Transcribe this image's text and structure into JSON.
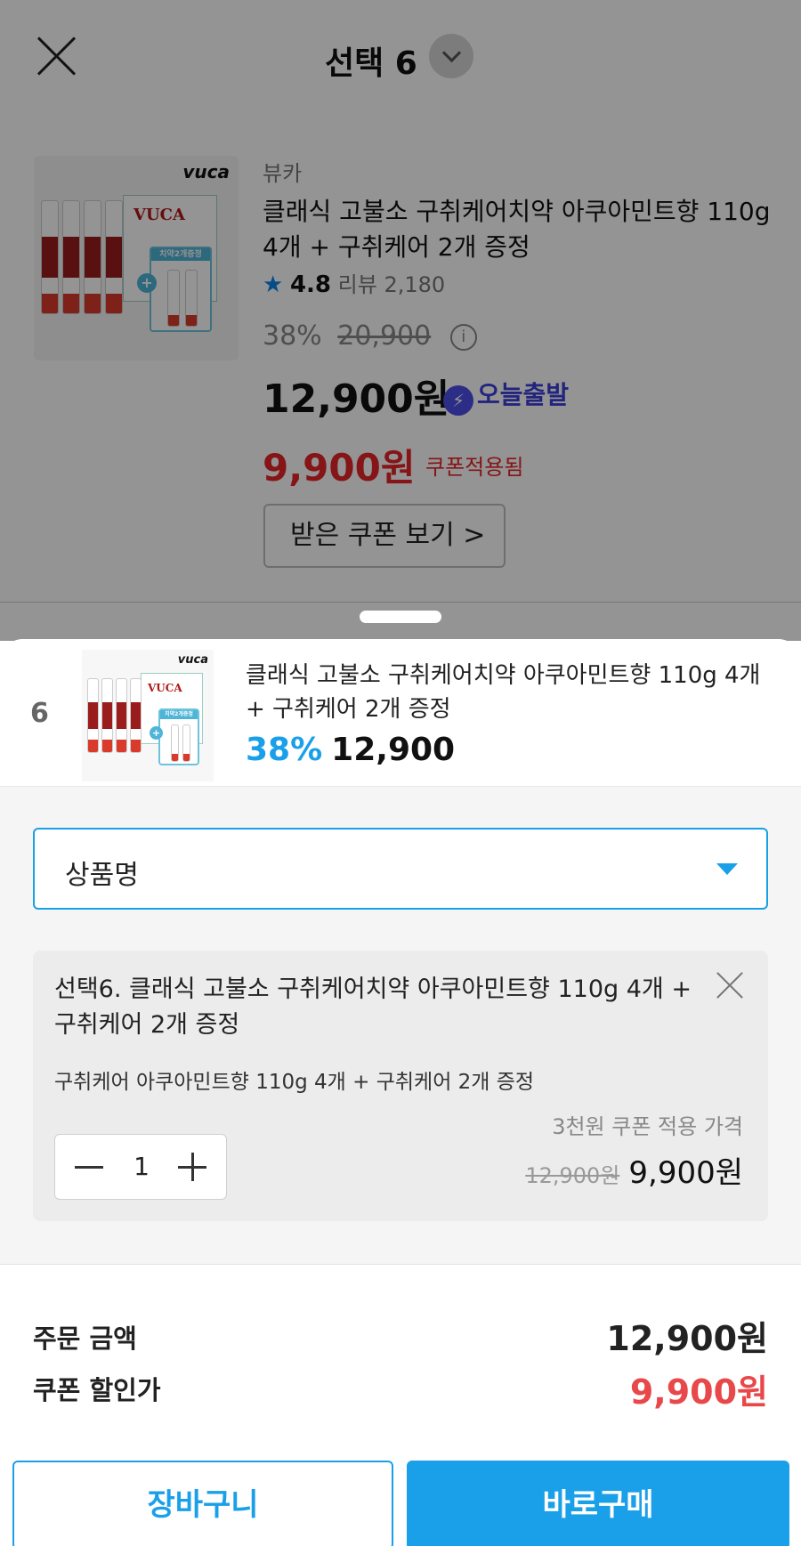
{
  "header": {
    "title": "선택 6"
  },
  "product": {
    "brand": "뷰카",
    "name": "클래식 고불소 구취케어치약 아쿠아민트향 110g 4개 + 구취케어 2개 증정",
    "rating": "4.8",
    "review_label": "리뷰 2,180",
    "discount_pct": "38%",
    "original_price": "20,900",
    "info_icon": "ⓘ",
    "price": "12,900원",
    "delivery_badge": "오늘출발",
    "coupon_price": "9,900원",
    "coupon_applied_label": "쿠폰적용됨",
    "coupon_button": "받은 쿠폰 보기 >",
    "image_logo": "vuca",
    "image_gift_tag": "치약2개증정",
    "image_brand_text": "VUCA"
  },
  "sheet": {
    "selected_index": "6",
    "selected_name": "클래식 고불소 구취케어치약 아쿠아민트향 110g 4개 + 구취케어 2개 증정",
    "selected_discount": "38%",
    "selected_price": "12,900",
    "select_value": "상품명",
    "option": {
      "title": "선택6. 클래식 고불소 구취케어치약 아쿠아민트향 110g 4개 + 구취케어 2개 증정",
      "subtitle": "구취케어 아쿠아민트향 110g 4개 + 구취케어 2개 증정",
      "coupon_note": "3천원 쿠폰 적용 가격",
      "quantity": "1",
      "original_price": "12,900원",
      "final_price": "9,900원"
    },
    "summary": {
      "order_label": "주문 금액",
      "order_value": "12,900원",
      "coupon_label": "쿠폰 할인가",
      "coupon_value": "9,900원"
    },
    "buttons": {
      "cart": "장바구니",
      "buy": "바로구매"
    }
  },
  "colors": {
    "accent": "#1aa0e8",
    "sale_red": "#e52528",
    "today_badge": "#3b3fd8"
  }
}
